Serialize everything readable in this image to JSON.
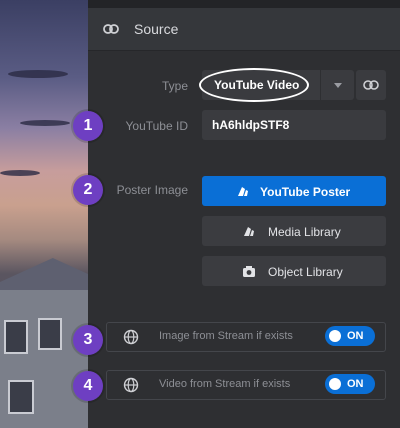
{
  "section": {
    "title": "Source",
    "icon": "link-icon"
  },
  "type_field": {
    "label": "Type",
    "value": "YouTube Video",
    "dropdown_icon": "chevron-down-icon",
    "link_icon": "link-icon"
  },
  "youtube_id": {
    "label": "YouTube ID",
    "value": "hA6hldpSTF8"
  },
  "poster": {
    "label": "Poster Image",
    "buttons": [
      {
        "label": "YouTube Poster",
        "icon": "poster-icon",
        "active": true
      },
      {
        "label": "Media Library",
        "icon": "poster-icon",
        "active": false
      },
      {
        "label": "Object Library",
        "icon": "camera-icon",
        "active": false
      }
    ]
  },
  "toggles": [
    {
      "label": "Image from Stream if exists",
      "state": "ON",
      "icon": "globe-icon"
    },
    {
      "label": "Video from Stream if exists",
      "state": "ON",
      "icon": "globe-icon"
    }
  ],
  "badges": [
    "1",
    "2",
    "3",
    "4"
  ],
  "colors": {
    "accent": "#0a6fd6",
    "badge": "#6e3fc2",
    "panel": "#2e2f32"
  }
}
